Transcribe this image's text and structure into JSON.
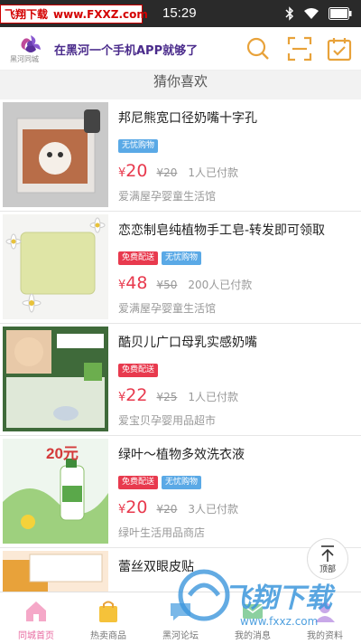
{
  "status_bar": {
    "watermark_label": "飞翔下载",
    "watermark_url": "www.FXXZ.com",
    "time": "15:29"
  },
  "header": {
    "logo_text": "黑河同城",
    "slogan": "在黑河一个手机APP就够了",
    "icons": [
      "search-icon",
      "scan-icon",
      "checkin-icon"
    ],
    "accent_color": "#e8a23a"
  },
  "section_title": "猜你喜欢",
  "currency": "¥",
  "products": [
    {
      "title": "邦尼熊宽口径奶嘴十字孔",
      "tags": [
        {
          "label": "无忧购物",
          "kind": "worry"
        }
      ],
      "price": "20",
      "old_price": "¥20",
      "sold": "1人已付款",
      "shop": "爱满屋孕婴童生活馆",
      "thumb": "pacifier-package"
    },
    {
      "title": "恋恋制皂纯植物手工皂-转发即可领取",
      "tags": [
        {
          "label": "免费配送",
          "kind": "free"
        },
        {
          "label": "无忧购物",
          "kind": "worry"
        }
      ],
      "price": "48",
      "old_price": "¥50",
      "sold": "200人已付款",
      "shop": "爱满屋孕婴童生活馆",
      "thumb": "handmade-soap"
    },
    {
      "title": "酷贝儿广口母乳实感奶嘴",
      "tags": [
        {
          "label": "免费配送",
          "kind": "free"
        }
      ],
      "price": "22",
      "old_price": "¥25",
      "sold": "1人已付款",
      "shop": "爱宝贝孕婴用品超市",
      "thumb": "nipple-box"
    },
    {
      "title": "绿叶～植物多效洗衣液",
      "tags": [
        {
          "label": "免费配送",
          "kind": "free"
        },
        {
          "label": "无忧购物",
          "kind": "worry"
        }
      ],
      "price": "20",
      "old_price": "¥20",
      "sold": "3人已付款",
      "shop": "绿叶生活用品商店",
      "thumb": "laundry-detergent",
      "thumb_badge": "20元"
    },
    {
      "title": "蕾丝双眼皮贴",
      "tags": [],
      "price": "",
      "old_price": "",
      "sold": "",
      "shop": "",
      "thumb": "eyelid-tape"
    }
  ],
  "back_to_top_label": "顶部",
  "bottom_nav": [
    {
      "label": "同城首页",
      "icon": "home-icon",
      "active": true
    },
    {
      "label": "热卖商品",
      "icon": "shopping-bag-icon",
      "active": false
    },
    {
      "label": "黑河论坛",
      "icon": "forum-icon",
      "active": false
    },
    {
      "label": "我的消息",
      "icon": "message-icon",
      "active": false
    },
    {
      "label": "我的资料",
      "icon": "profile-icon",
      "active": false
    }
  ],
  "overlay_watermark": {
    "big": "飞翔下载",
    "small": "www.fxxz.com"
  }
}
